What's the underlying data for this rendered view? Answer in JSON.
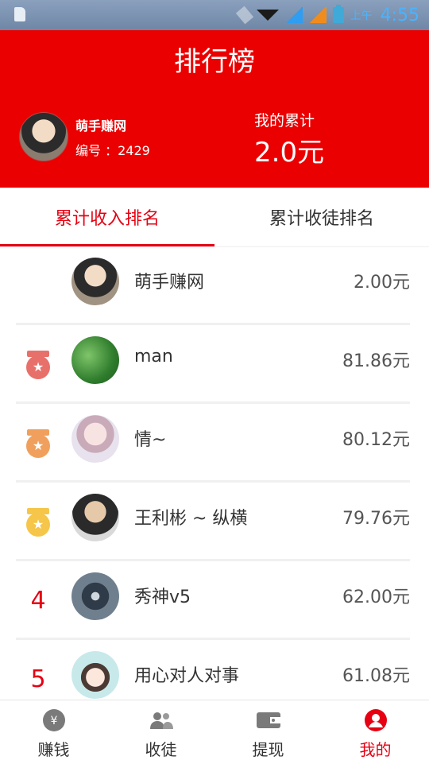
{
  "status_bar": {
    "ampm": "上午",
    "time": "4:55"
  },
  "header": {
    "title": "排行榜",
    "user_name": "萌手赚网",
    "user_id": "编号 ：2429",
    "total_label": "我的累计",
    "total_value": "2.0元"
  },
  "tabs": [
    {
      "label": "累计收入排名",
      "active": true
    },
    {
      "label": "累计收徒排名",
      "active": false
    }
  ],
  "list": [
    {
      "rank": "",
      "name": "萌手赚网",
      "amount": "2.00元"
    },
    {
      "rank": "",
      "medal": "medal-icon",
      "name": "man",
      "amount": "81.86元"
    },
    {
      "rank": "",
      "medal": "medal-icon",
      "name": "情~",
      "amount": "80.12元"
    },
    {
      "rank": "",
      "medal": "medal-icon",
      "name": "王利彬 ~ 纵横",
      "amount": "79.76元"
    },
    {
      "rank": "4",
      "name": "秀神v5",
      "amount": "62.00元"
    },
    {
      "rank": "5",
      "name": "用心对人对事",
      "amount": "61.08元"
    }
  ],
  "bottom_nav": [
    {
      "label": "赚钱",
      "icon": "yen-icon"
    },
    {
      "label": "收徒",
      "icon": "users-icon"
    },
    {
      "label": "提现",
      "icon": "wallet-icon"
    },
    {
      "label": "我的",
      "icon": "user-icon",
      "active": true
    }
  ],
  "colors": {
    "primary": "#ea0000",
    "accent": "#e60012",
    "gold": "#f5c64a",
    "silver": "#f0a05c",
    "bronze": "#e8706a"
  }
}
